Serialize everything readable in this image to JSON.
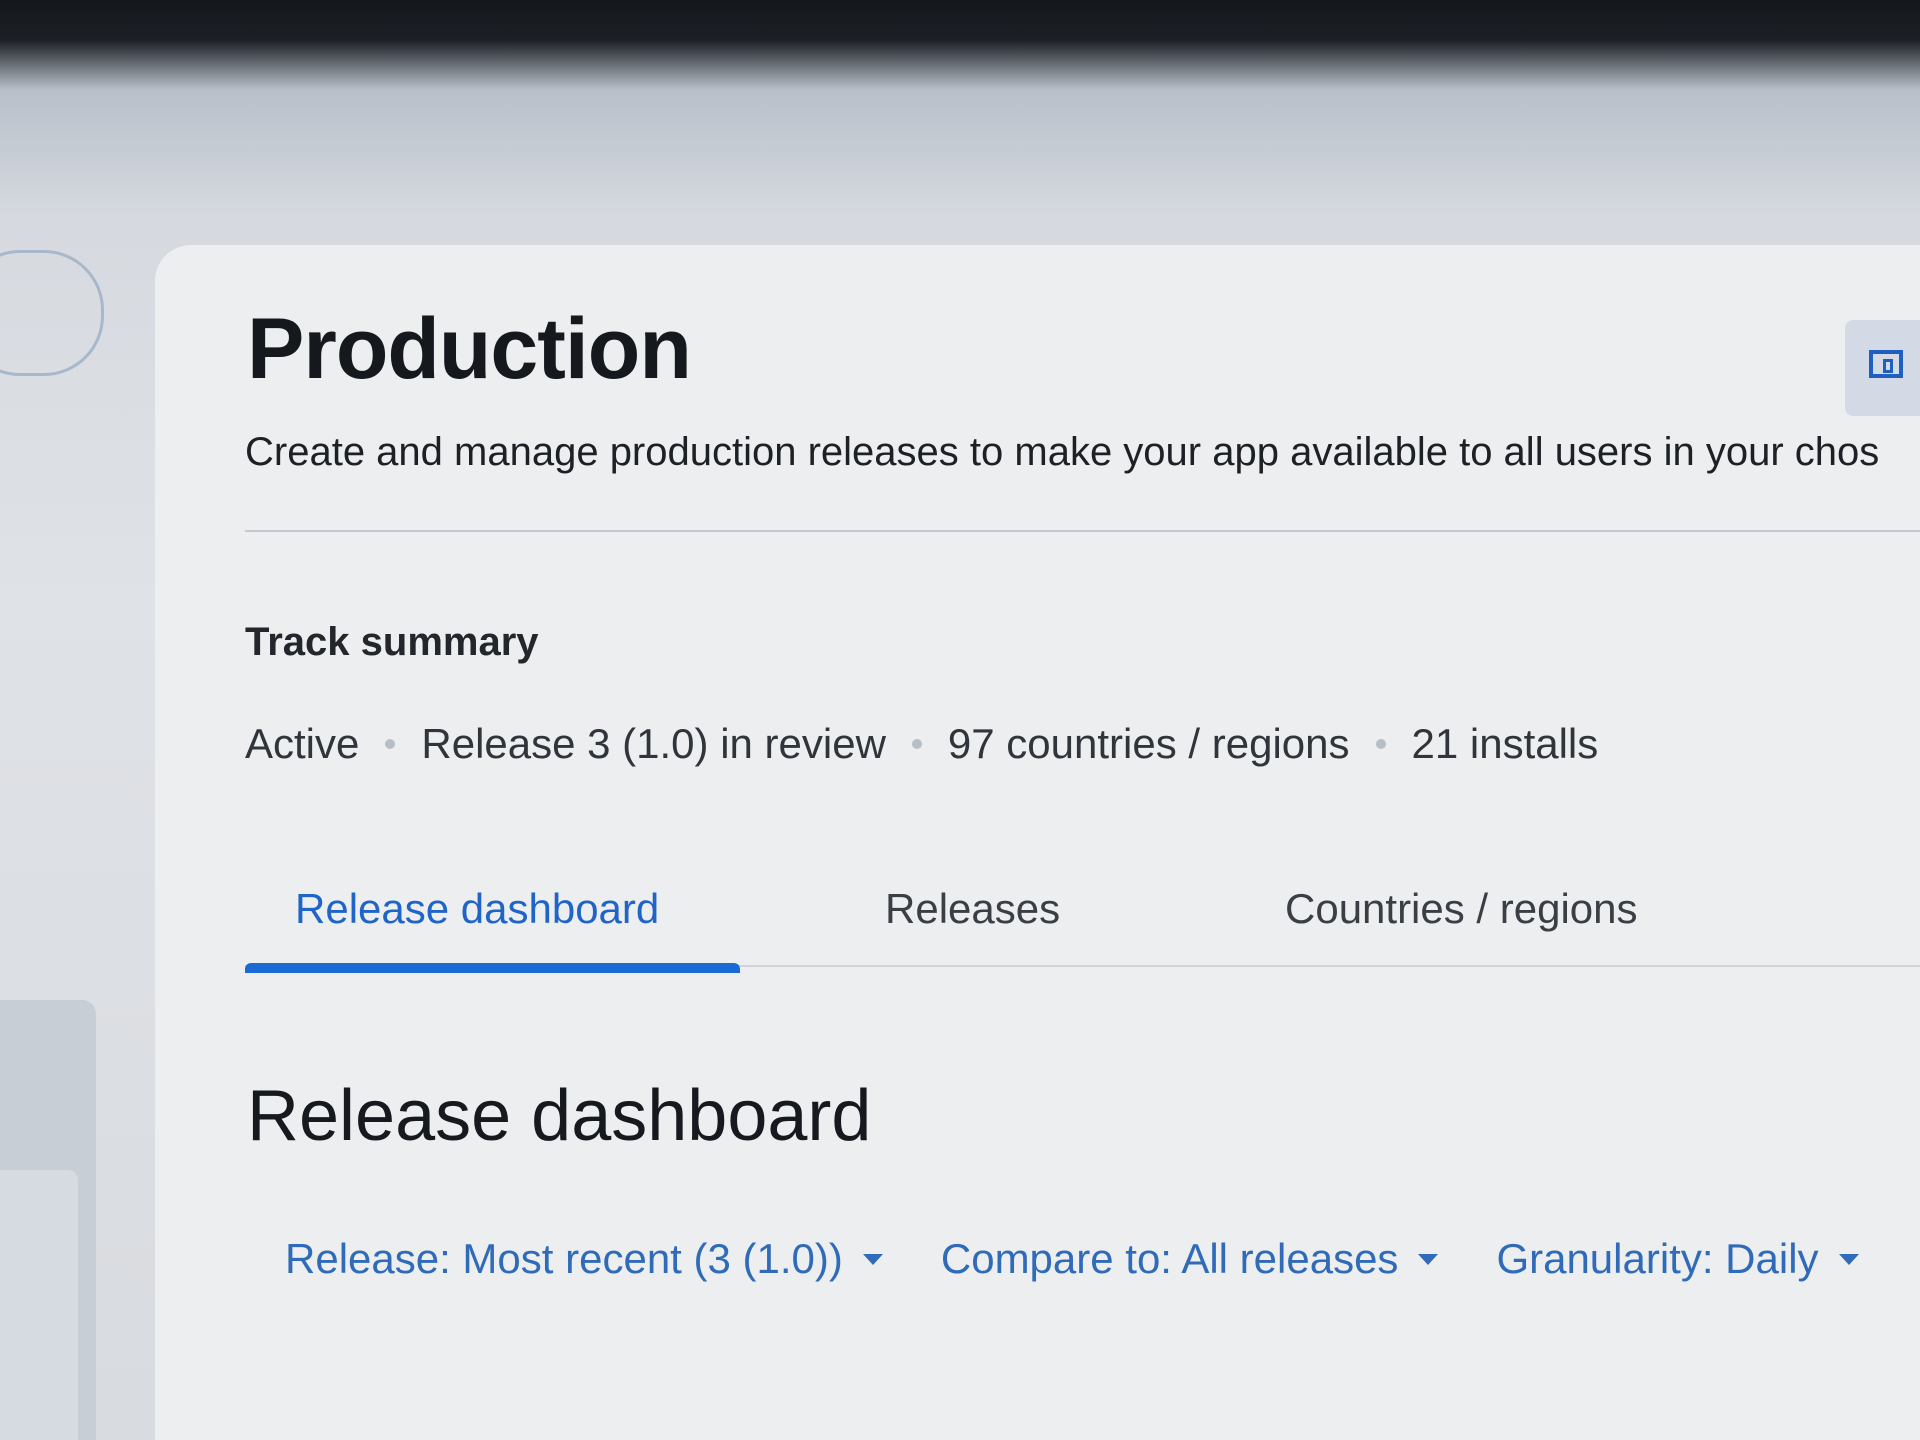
{
  "page": {
    "title": "Production",
    "description": "Create and manage production releases to make your app available to all users in your chos"
  },
  "track_summary": {
    "label": "Track summary",
    "status": "Active",
    "release": "Release 3 (1.0) in review",
    "countries": "97 countries / regions",
    "installs": "21 installs"
  },
  "tabs": [
    {
      "label": "Release dashboard",
      "active": true
    },
    {
      "label": "Releases",
      "active": false
    },
    {
      "label": "Countries / regions",
      "active": false
    }
  ],
  "dashboard": {
    "title": "Release dashboard",
    "filters": {
      "release": "Release: Most recent (3 (1.0))",
      "compare": "Compare to: All releases",
      "granularity": "Granularity: Daily"
    }
  },
  "colors": {
    "accent": "#1a6ad4",
    "link": "#2f6bb8",
    "text": "#15181c"
  },
  "icons": {
    "corner_button": "devices-icon",
    "dropdown": "caret-down-icon"
  }
}
